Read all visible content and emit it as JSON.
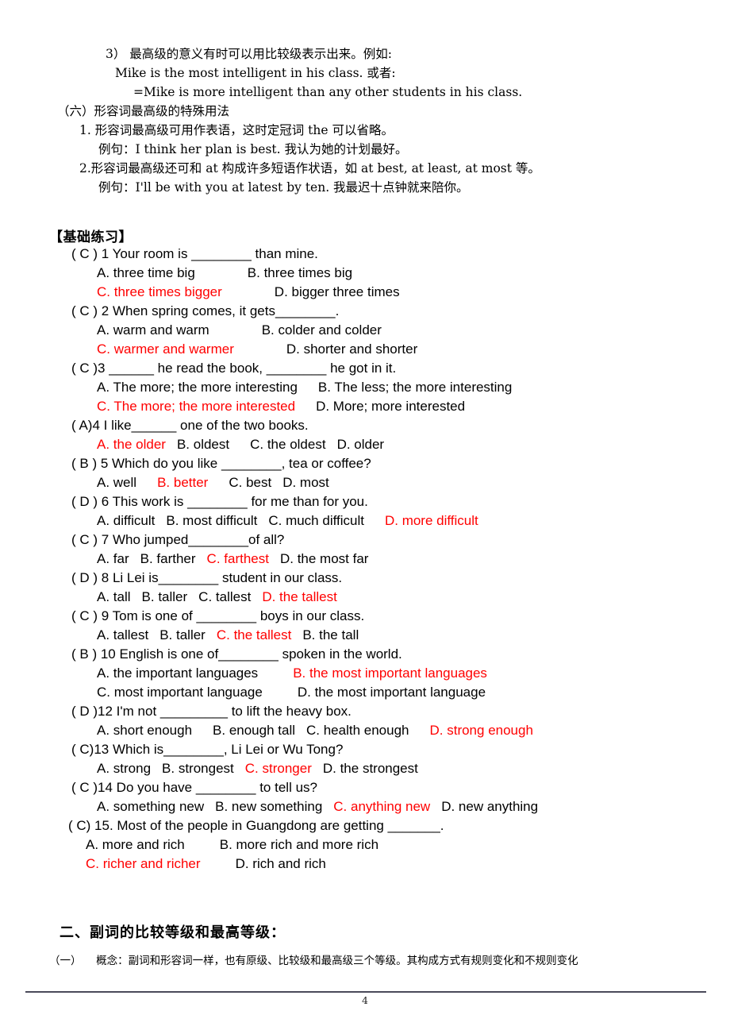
{
  "document": {
    "page_number": "4"
  },
  "grammar": {
    "lines": [
      {
        "indent": "i-133",
        "text": "3）  最高级的意义有时可以用比较级表示出来。例如:"
      },
      {
        "indent": "i-145",
        "text": "Mike is the most intelligent in his class. 或者:"
      },
      {
        "indent": "i-168",
        "text": "=Mike is more intelligent than any other students in his class."
      },
      {
        "indent": "i-72",
        "text": "（六）形容词最高级的特殊用法"
      },
      {
        "indent": "i-100",
        "text": "1. 形容词最高级可用作表语，这时定冠词 the 可以省略。"
      },
      {
        "indent": "i-124",
        "text": "例句：I think her plan is best. 我认为她的计划最好。"
      },
      {
        "indent": "i-100",
        "text": "2.形容词最高级还可和 at 构成许多短语作状语，如 at best, at least, at most 等。"
      },
      {
        "indent": "i-124",
        "text": "例句：I'll be with you at latest by ten.  我最迟十点钟就来陪你。"
      }
    ]
  },
  "exercise": {
    "heading": "【基础练习】",
    "questions": [
      {
        "stem": "(  C ) 1 Your room is ________ than mine.",
        "option_lines": [
          [
            {
              "text": "A. three time big",
              "red": false
            },
            {
              "text": "B. three times big",
              "red": false
            }
          ],
          [
            {
              "text": "C. three times bigger",
              "red": true
            },
            {
              "text": "D. bigger three times",
              "red": false
            }
          ]
        ],
        "gaps": [
          "gap-xl",
          "gap-l"
        ]
      },
      {
        "stem": "(  C ) 2 When spring comes, it gets________.",
        "option_lines": [
          [
            {
              "text": "A. warm and warm",
              "red": false
            },
            {
              "text": "B. colder and colder",
              "red": false
            }
          ],
          [
            {
              "text": "C. warmer and warmer",
              "red": true
            },
            {
              "text": "D. shorter and shorter",
              "red": false
            }
          ]
        ],
        "gaps": [
          "gap-xl",
          "gap-l"
        ]
      },
      {
        "stem": "(  C )3 ______ he read the book, ________ he got in it.",
        "option_lines": [
          [
            {
              "text": "A. The more; the more interesting",
              "red": false
            },
            {
              "text": "B. The less; the more interesting",
              "red": false
            }
          ],
          [
            {
              "text": "C. The more; the more interested",
              "red": true
            },
            {
              "text": "D. More; more interested",
              "red": false
            }
          ]
        ],
        "gaps": [
          "gap-m",
          "gap-m"
        ]
      },
      {
        "stem": "(  A)4 I like______ one of the two books.",
        "option_lines": [
          [
            {
              "text": "A. the older",
              "red": true
            },
            {
              "text": "B. oldest",
              "red": false
            },
            {
              "text": "C. the oldest",
              "red": false
            },
            {
              "text": "D. older",
              "red": false
            }
          ]
        ],
        "gaps": [
          "gap-s",
          "gap-m",
          "gap-s"
        ]
      },
      {
        "stem": "(  B ) 5 Which do you like ________, tea or coffee?",
        "option_lines": [
          [
            {
              "text": "A. well",
              "red": false
            },
            {
              "text": "B. better",
              "red": true
            },
            {
              "text": "C. best",
              "red": false
            },
            {
              "text": "D. most",
              "red": false
            }
          ]
        ],
        "gaps": [
          "gap-m",
          "gap-m",
          "gap-s"
        ]
      },
      {
        "stem": "(  D ) 6 This work is ________ for me than for you.",
        "option_lines": [
          [
            {
              "text": "A. difficult",
              "red": false
            },
            {
              "text": "B. most difficult",
              "red": false
            },
            {
              "text": "C. much difficult",
              "red": false
            },
            {
              "text": "D. more difficult",
              "red": true
            }
          ]
        ],
        "gaps": [
          "gap-s",
          "gap-s",
          "gap-m"
        ]
      },
      {
        "stem": "(  C ) 7 Who jumped________of all?",
        "option_lines": [
          [
            {
              "text": "A. far",
              "red": false
            },
            {
              "text": "B. farther",
              "red": false
            },
            {
              "text": "C. farthest",
              "red": true
            },
            {
              "text": "D. the most far",
              "red": false
            }
          ]
        ],
        "gaps": [
          "gap-s",
          "gap-s",
          "gap-s"
        ]
      },
      {
        "stem": "(  D ) 8 Li Lei is________ student in our class.",
        "option_lines": [
          [
            {
              "text": "A. tall",
              "red": false
            },
            {
              "text": "B. taller",
              "red": false
            },
            {
              "text": "C. tallest",
              "red": false
            },
            {
              "text": "D. the tallest",
              "red": true
            }
          ]
        ],
        "gaps": [
          "gap-s",
          "gap-s",
          "gap-s"
        ]
      },
      {
        "stem": "(  C ) 9 Tom is one of ________ boys in our class.",
        "option_lines": [
          [
            {
              "text": "A. tallest",
              "red": false
            },
            {
              "text": "B. taller",
              "red": false
            },
            {
              "text": "C. the tallest",
              "red": true
            },
            {
              "text": "B. the tall",
              "red": false
            }
          ]
        ],
        "gaps": [
          "gap-s",
          "gap-s",
          "gap-s"
        ]
      },
      {
        "stem": "(  B ) 10 English is one of________ spoken in the world.",
        "option_lines": [
          [
            {
              "text": "A. the important languages",
              "red": false
            },
            {
              "text": "B. the most important languages",
              "red": true
            }
          ],
          [
            {
              "text": "C. most important language",
              "red": false
            },
            {
              "text": "D. the most important language",
              "red": false
            }
          ]
        ],
        "gaps": [
          "gap-l",
          "gap-l"
        ]
      },
      {
        "stem": "( D  )12 I'm not _________ to lift the heavy box.",
        "option_lines": [
          [
            {
              "text": "A. short enough",
              "red": false
            },
            {
              "text": "B. enough tall",
              "red": false
            },
            {
              "text": "C. health enough",
              "red": false
            },
            {
              "text": "D. strong enough",
              "red": true
            }
          ]
        ],
        "gaps": [
          "gap-m",
          "gap-s",
          "gap-m"
        ]
      },
      {
        "stem": "(  C)13 Which is________, Li Lei or Wu Tong?",
        "option_lines": [
          [
            {
              "text": "A. strong",
              "red": false
            },
            {
              "text": "B. strongest",
              "red": false
            },
            {
              "text": "C. stronger",
              "red": true
            },
            {
              "text": "D. the strongest",
              "red": false
            }
          ]
        ],
        "gaps": [
          "gap-s",
          "gap-s",
          "gap-s"
        ]
      },
      {
        "stem": "(  C )14 Do you have ________ to tell us?",
        "option_lines": [
          [
            {
              "text": "A. something new",
              "red": false
            },
            {
              "text": "B. new something",
              "red": false
            },
            {
              "text": "C. anything new",
              "red": true
            },
            {
              "text": "D. new anything",
              "red": false
            }
          ]
        ],
        "gaps": [
          "gap-s",
          "gap-s",
          "gap-s"
        ]
      },
      {
        "stem": "(  C) 15. Most of the people in Guangdong are getting _______.",
        "option_lines": [
          [
            {
              "text": "A. more and rich",
              "red": false
            },
            {
              "text": "B. more rich and more rich",
              "red": false
            }
          ],
          [
            {
              "text": "C. richer and richer",
              "red": true
            },
            {
              "text": "D. rich and rich",
              "red": false
            }
          ]
        ],
        "gaps": [
          "gap-l",
          "gap-l"
        ],
        "narrow": true,
        "tight": true
      }
    ]
  },
  "section_two": {
    "heading": "二、副词的比较等级和最高等级：",
    "paragraph_label": "（一）",
    "paragraph_text": "概念：副词和形容词一样，也有原级、比较级和最高级三个等级。其构成方式有规则变化和不规则变化"
  }
}
